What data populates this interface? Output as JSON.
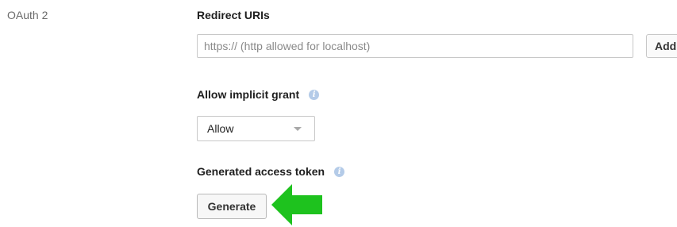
{
  "section": {
    "label": "OAuth 2"
  },
  "redirect_uris": {
    "title": "Redirect URIs",
    "placeholder": "https:// (http allowed for localhost)",
    "value": "",
    "add_label": "Add"
  },
  "implicit_grant": {
    "title": "Allow implicit grant",
    "info_icon": "info-icon",
    "selected": "Allow"
  },
  "access_token": {
    "title": "Generated access token",
    "info_icon": "info-icon",
    "generate_label": "Generate"
  },
  "annotation": {
    "icon": "green-arrow-left",
    "color": "#1ec21e"
  },
  "colors": {
    "info_icon": "#b4cbe8",
    "border": "#c8c8c8",
    "muted_text": "#6b6b6b"
  }
}
